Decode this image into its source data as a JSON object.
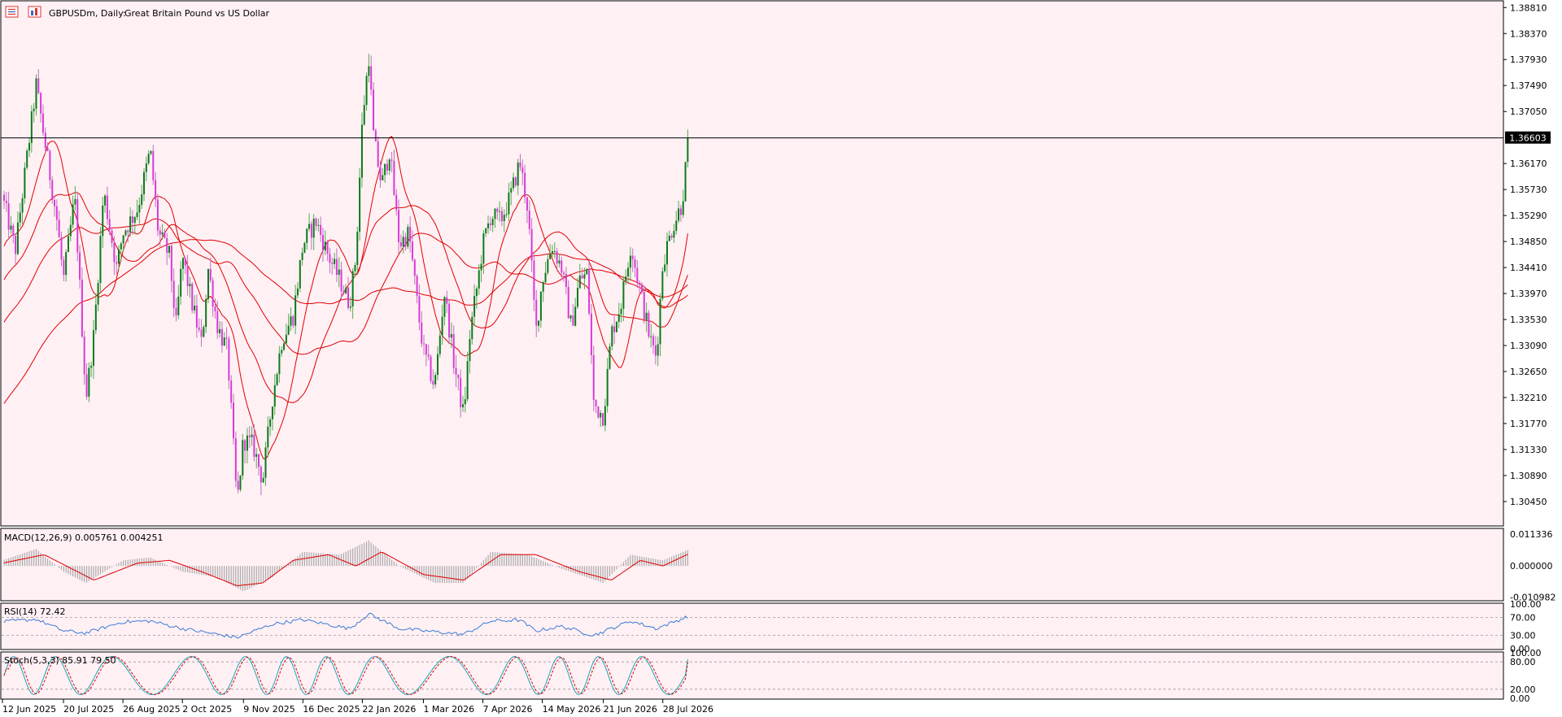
{
  "title": {
    "symbol_timeframe": "GBPUSDm, Daily:",
    "description": "Great Britain Pound vs US Dollar",
    "icons": [
      "list-icon",
      "bar-chart-icon"
    ]
  },
  "current_price": "1.36603",
  "colors": {
    "background": "#fff0f4",
    "frame": "#000000",
    "bull": "#0a7a1a",
    "bull_wick": "#55aa55",
    "bear": "#d63bd6",
    "bear_wick": "#c070c0",
    "ma": "#e00000",
    "macd_hist": "#aaaaaa",
    "macd_signal": "#e00000",
    "rsi": "#3a7bd5",
    "stoch_main": "#1aa6b7",
    "stoch_signal": "#e00000",
    "price_line": "#000000"
  },
  "chart_data": [
    {
      "type": "candlestick",
      "title": "GBPUSDm, Daily:  Great Britain Pound vs US Dollar",
      "ylim": [
        1.3005,
        1.3891
      ],
      "y_ticks": [
        "1.38810",
        "1.38370",
        "1.37930",
        "1.37490",
        "1.37050",
        "1.36170",
        "1.35730",
        "1.35290",
        "1.34850",
        "1.34410",
        "1.33970",
        "1.33530",
        "1.33090",
        "1.32650",
        "1.32210",
        "1.31770",
        "1.31330",
        "1.30890",
        "1.30450"
      ],
      "x_ticks": [
        "12 Jun 2025",
        "20 Jul 2025",
        "26 Aug 2025",
        "2 Oct 2025",
        "9 Nov 2025",
        "16 Dec 2025",
        "22 Jan 2026",
        "1 Mar 2026",
        "7 Apr 2026",
        "14 May 2026",
        "21 Jun 2026",
        "28 Jul 2026"
      ],
      "current_price": 1.36603,
      "close_path": [
        [
          "12 Jun 2025",
          1.356
        ],
        [
          "20 Jun 2025",
          1.347
        ],
        [
          "26 Jun 2025",
          1.36
        ],
        [
          "3 Jul 2025",
          1.375
        ],
        [
          "8 Jul 2025",
          1.366
        ],
        [
          "16 Jul 2025",
          1.352
        ],
        [
          "20 Jul 2025",
          1.342
        ],
        [
          "27 Jul 2025",
          1.356
        ],
        [
          "3 Aug 2025",
          1.322
        ],
        [
          "8 Aug 2025",
          1.333
        ],
        [
          "14 Aug 2025",
          1.357
        ],
        [
          "22 Aug 2025",
          1.344
        ],
        [
          "26 Aug 2025",
          1.35
        ],
        [
          "4 Sep 2025",
          1.354
        ],
        [
          "12 Sep 2025",
          1.364
        ],
        [
          "17 Sep 2025",
          1.35
        ],
        [
          "24 Sep 2025",
          1.346
        ],
        [
          "28 Sep 2025",
          1.334
        ],
        [
          "2 Oct 2025",
          1.346
        ],
        [
          "8 Oct 2025",
          1.338
        ],
        [
          "14 Oct 2025",
          1.331
        ],
        [
          "18 Oct 2025",
          1.344
        ],
        [
          "24 Oct 2025",
          1.334
        ],
        [
          "30 Oct 2025",
          1.33
        ],
        [
          "5 Nov 2025",
          1.304
        ],
        [
          "9 Nov 2025",
          1.315
        ],
        [
          "15 Nov 2025",
          1.314
        ],
        [
          "21 Nov 2025",
          1.308
        ],
        [
          "27 Nov 2025",
          1.322
        ],
        [
          "3 Dec 2025",
          1.332
        ],
        [
          "10 Dec 2025",
          1.336
        ],
        [
          "16 Dec 2025",
          1.348
        ],
        [
          "24 Dec 2025",
          1.352
        ],
        [
          "1 Jan 2026",
          1.346
        ],
        [
          "8 Jan 2026",
          1.342
        ],
        [
          "14 Jan 2026",
          1.338
        ],
        [
          "18 Jan 2026",
          1.346
        ],
        [
          "22 Jan 2026",
          1.369
        ],
        [
          "26 Jan 2026",
          1.38
        ],
        [
          "29 Jan 2026",
          1.366
        ],
        [
          "3 Feb 2026",
          1.358
        ],
        [
          "8 Feb 2026",
          1.364
        ],
        [
          "14 Feb 2026",
          1.348
        ],
        [
          "20 Feb 2026",
          1.35
        ],
        [
          "26 Feb 2026",
          1.336
        ],
        [
          "1 Mar 2026",
          1.33
        ],
        [
          "8 Mar 2026",
          1.324
        ],
        [
          "14 Mar 2026",
          1.34
        ],
        [
          "20 Mar 2026",
          1.328
        ],
        [
          "26 Mar 2026",
          1.319
        ],
        [
          "30 Mar 2026",
          1.333
        ],
        [
          "4 Apr 2026",
          1.342
        ],
        [
          "7 Apr 2026",
          1.348
        ],
        [
          "12 Apr 2026",
          1.353
        ],
        [
          "18 Apr 2026",
          1.352
        ],
        [
          "24 Apr 2026",
          1.356
        ],
        [
          "30 Apr 2026",
          1.362
        ],
        [
          "5 May 2026",
          1.354
        ],
        [
          "10 May 2026",
          1.333
        ],
        [
          "14 May 2026",
          1.342
        ],
        [
          "20 May 2026",
          1.348
        ],
        [
          "26 May 2026",
          1.344
        ],
        [
          "1 Jun 2026",
          1.334
        ],
        [
          "6 Jun 2026",
          1.342
        ],
        [
          "11 Jun 2026",
          1.343
        ],
        [
          "15 Jun 2026",
          1.321
        ],
        [
          "21 Jun 2026",
          1.319
        ],
        [
          "26 Jun 2026",
          1.333
        ],
        [
          "2 Jul 2026",
          1.338
        ],
        [
          "8 Jul 2026",
          1.348
        ],
        [
          "14 Jul 2026",
          1.34
        ],
        [
          "20 Jul 2026",
          1.332
        ],
        [
          "24 Jul 2026",
          1.329
        ],
        [
          "28 Jul 2026",
          1.345
        ],
        [
          "3 Aug 2026",
          1.351
        ],
        [
          "9 Aug 2026",
          1.355
        ],
        [
          "13 Aug 2026",
          1.366
        ]
      ],
      "moving_averages": 4
    },
    {
      "type": "bar",
      "title": "MACD(12,26,9) 0.005761 0.004251",
      "ylim": [
        -0.012,
        0.013
      ],
      "y_ticks": [
        "0.011336",
        "0.000000",
        "-0.010982"
      ],
      "macd_path": [
        [
          "12 Jun 2025",
          0.002
        ],
        [
          "3 Jul 2025",
          0.006
        ],
        [
          "20 Jul 2025",
          -0.002
        ],
        [
          "3 Aug 2025",
          -0.006
        ],
        [
          "26 Aug 2025",
          0.002
        ],
        [
          "12 Sep 2025",
          0.003
        ],
        [
          "2 Oct 2025",
          -0.002
        ],
        [
          "24 Oct 2025",
          -0.004
        ],
        [
          "9 Nov 2025",
          -0.009
        ],
        [
          "27 Nov 2025",
          -0.004
        ],
        [
          "16 Dec 2025",
          0.005
        ],
        [
          "8 Jan 2026",
          0.004
        ],
        [
          "26 Jan 2026",
          0.009
        ],
        [
          "14 Feb 2026",
          0.0
        ],
        [
          "8 Mar 2026",
          -0.006
        ],
        [
          "26 Mar 2026",
          -0.006
        ],
        [
          "12 Apr 2026",
          0.005
        ],
        [
          "5 May 2026",
          0.004
        ],
        [
          "26 May 2026",
          -0.001
        ],
        [
          "21 Jun 2026",
          -0.006
        ],
        [
          "8 Jul 2026",
          0.004
        ],
        [
          "28 Jul 2026",
          0.002
        ],
        [
          "13 Aug 2026",
          0.0058
        ]
      ],
      "signal_path": [
        [
          "12 Jun 2025",
          0.001
        ],
        [
          "8 Jul 2025",
          0.004
        ],
        [
          "8 Aug 2025",
          -0.005
        ],
        [
          "4 Sep 2025",
          0.001
        ],
        [
          "24 Sep 2025",
          0.002
        ],
        [
          "14 Oct 2025",
          -0.002
        ],
        [
          "5 Nov 2025",
          -0.007
        ],
        [
          "21 Nov 2025",
          -0.006
        ],
        [
          "10 Dec 2025",
          0.002
        ],
        [
          "1 Jan 2026",
          0.004
        ],
        [
          "18 Jan 2026",
          0.0
        ],
        [
          "3 Feb 2026",
          0.005
        ],
        [
          "1 Mar 2026",
          -0.003
        ],
        [
          "26 Mar 2026",
          -0.005
        ],
        [
          "18 Apr 2026",
          0.004
        ],
        [
          "10 May 2026",
          0.004
        ],
        [
          "6 Jun 2026",
          -0.002
        ],
        [
          "26 Jun 2026",
          -0.005
        ],
        [
          "14 Jul 2026",
          0.002
        ],
        [
          "28 Jul 2026",
          0.0
        ],
        [
          "13 Aug 2026",
          0.00425
        ]
      ]
    },
    {
      "type": "line",
      "title": "RSI(14) 72.42",
      "ylim": [
        0,
        100
      ],
      "y_ticks": [
        "100.00",
        "70.00",
        "30.00",
        "0.00"
      ],
      "levels": [
        70,
        30
      ],
      "path": [
        [
          "12 Jun 2025",
          60
        ],
        [
          "3 Jul 2025",
          66
        ],
        [
          "20 Jul 2025",
          40
        ],
        [
          "3 Aug 2025",
          35
        ],
        [
          "26 Aug 2025",
          60
        ],
        [
          "12 Sep 2025",
          62
        ],
        [
          "2 Oct 2025",
          45
        ],
        [
          "5 Nov 2025",
          25
        ],
        [
          "27 Nov 2025",
          55
        ],
        [
          "16 Dec 2025",
          65
        ],
        [
          "14 Jan 2026",
          45
        ],
        [
          "26 Jan 2026",
          78
        ],
        [
          "14 Feb 2026",
          45
        ],
        [
          "8 Mar 2026",
          38
        ],
        [
          "26 Mar 2026",
          32
        ],
        [
          "12 Apr 2026",
          62
        ],
        [
          "30 Apr 2026",
          64
        ],
        [
          "10 May 2026",
          40
        ],
        [
          "26 May 2026",
          50
        ],
        [
          "15 Jun 2026",
          30
        ],
        [
          "8 Jul 2026",
          62
        ],
        [
          "24 Jul 2026",
          45
        ],
        [
          "13 Aug 2026",
          72.42
        ]
      ]
    },
    {
      "type": "line",
      "title": "Stoch(5,3,3) 85.91 79.50",
      "ylim": [
        0,
        100
      ],
      "y_ticks": [
        "100.00",
        "80.00",
        "20.00",
        "0.00"
      ],
      "levels": [
        80,
        20
      ],
      "last_values": [
        85.91,
        79.5
      ]
    }
  ]
}
